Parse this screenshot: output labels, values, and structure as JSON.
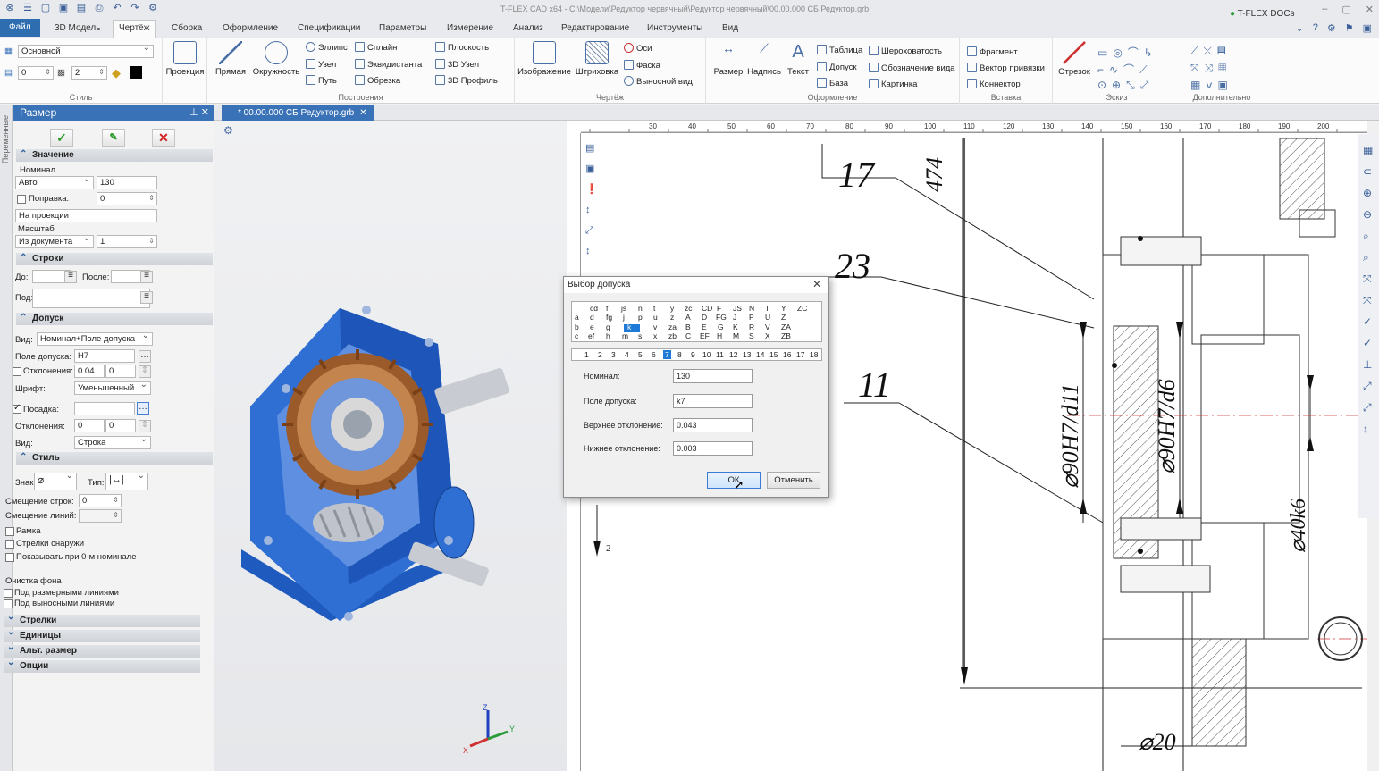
{
  "titlebar": {
    "title": "T-FLEX CAD x64 - C:\\Модели\\Редуктор червячный\\Редуктор червячный\\00.00.000 СБ Редуктор.grb",
    "docs_label": "T-FLEX DOCs"
  },
  "tabs": [
    "Файл",
    "3D Модель",
    "Чертёж",
    "Сборка",
    "Оформление",
    "Спецификации",
    "Параметры",
    "Измерение",
    "Анализ",
    "Редактирование",
    "Инструменты",
    "Вид"
  ],
  "ribbon": {
    "style": {
      "layer": "Основной",
      "v1": "0",
      "v2": "2",
      "label": "Стиль"
    },
    "projection": "Проекция",
    "build": {
      "line": "Прямая",
      "circle": "Окружность",
      "ellipse": "Эллипс",
      "spline": "Сплайн",
      "node": "Узел",
      "equidistant": "Эквидистанта",
      "path": "Путь",
      "trim": "Обрезка",
      "plane": "Плоскость",
      "node3d": "3D Узел",
      "profile3d": "3D Профиль",
      "label": "Построения"
    },
    "drawing": {
      "image": "Изображение",
      "hatch": "Штриховка",
      "axes": "Оси",
      "chamfer": "Фаска",
      "callout": "Выносной вид",
      "label": "Чертёж"
    },
    "format": {
      "size": "Размер",
      "inscription": "Надпись",
      "text": "Текст",
      "table": "Таблица",
      "tolerance": "Допуск",
      "base": "База",
      "roughness": "Шероховатость",
      "view_mark": "Обозначение вида",
      "picture": "Картинка",
      "label": "Оформление"
    },
    "insert": {
      "fragment": "Фрагмент",
      "snap_vector": "Вектор привязки",
      "connector": "Коннектор",
      "label": "Вставка"
    },
    "sketch": {
      "segment": "Отрезок",
      "label": "Эскиз"
    },
    "extra": {
      "label": "Дополнительно"
    }
  },
  "left_strip": "Переменные",
  "panel": {
    "title": "Размер",
    "sections": {
      "value": "Значение",
      "lines": "Строки",
      "tolerance": "Допуск",
      "style": "Стиль",
      "arrows": "Стрелки",
      "units": "Единицы",
      "alt": "Альт. размер",
      "options": "Опции"
    },
    "nominal_label": "Номинал",
    "nominal_mode": "Авто",
    "nominal_value": "130",
    "correction_label": "Поправка:",
    "correction_value": "0",
    "projection_btn": "На проекции",
    "scale_label": "Масштаб",
    "scale_mode": "Из документа",
    "scale_value": "1",
    "before_label": "До:",
    "after_label": "После:",
    "under_label": "Под:",
    "view_label": "Вид:",
    "view_value": "Номинал+Поле допуска",
    "field_label": "Поле допуска:",
    "field_value": "H7",
    "deviation_label": "Отклонения:",
    "deviation_v1": "0.04",
    "deviation_v2": "0",
    "font_label": "Шрифт:",
    "font_value": "Уменьшенный",
    "fit_label": "Посадка:",
    "fit_dev_label": "Отклонения:",
    "fit_dev_v1": "0",
    "fit_dev_v2": "0",
    "fit_view_label": "Вид:",
    "fit_view_value": "Строка",
    "sign_label": "Знак:",
    "type_label": "Тип:",
    "row_offset_label": "Смещение строк:",
    "row_offset_value": "0",
    "line_offset_label": "Смещение линий:",
    "frame_label": "Рамка",
    "arrows_out_label": "Стрелки снаружи",
    "show_zero_label": "Показывать при 0-м номинале",
    "bg_clear_label": "Очистка фона",
    "under_dim_label": "Под размерными линиями",
    "under_ext_label": "Под выносными линиями"
  },
  "document_tab": "* 00.00.000 СБ Редуктор.grb",
  "drawing": {
    "labels": [
      "17",
      "23",
      "11",
      "474",
      "⌀90H7/d11",
      "⌀90H7/d6",
      "⌀40k6",
      "⌀20",
      "2"
    ],
    "ruler": [
      "30",
      "40",
      "50",
      "60",
      "70",
      "80",
      "90",
      "100",
      "110",
      "120",
      "130",
      "140",
      "150",
      "160",
      "170",
      "180",
      "190",
      "200"
    ]
  },
  "dialog": {
    "title": "Выбор допуска",
    "letters": [
      [
        "",
        "cd",
        "f",
        "js",
        "n",
        "t",
        "y",
        "zc",
        "CD",
        "F",
        "JS",
        "N",
        "T",
        "Y",
        "ZC"
      ],
      [
        "a",
        "d",
        "fg",
        "j",
        "p",
        "u",
        "z",
        "A",
        "D",
        "FG",
        "J",
        "P",
        "U",
        "Z",
        ""
      ],
      [
        "b",
        "e",
        "g",
        "k",
        "r",
        "v",
        "za",
        "B",
        "E",
        "G",
        "K",
        "R",
        "V",
        "ZA",
        ""
      ],
      [
        "c",
        "ef",
        "h",
        "m",
        "s",
        "x",
        "zb",
        "C",
        "EF",
        "H",
        "M",
        "S",
        "X",
        "ZB",
        ""
      ]
    ],
    "numbers": [
      "1",
      "2",
      "3",
      "4",
      "5",
      "6",
      "7",
      "8",
      "9",
      "10",
      "11",
      "12",
      "13",
      "14",
      "15",
      "16",
      "17",
      "18"
    ],
    "selected_number": "7",
    "nominal_label": "Номинал:",
    "nominal_value": "130",
    "field_label": "Поле допуска:",
    "field_value": "k7",
    "upper_label": "Верхнее отклонение:",
    "upper_value": "0.043",
    "lower_label": "Нижнее отклонение:",
    "lower_value": "0.003",
    "ok_label": "ОК",
    "cancel_label": "Отменить"
  },
  "colors": {
    "accent": "#3a72b8",
    "selection": "#1f7ad6",
    "model_blue": "#2f6fd3",
    "gear_brown": "#9a5a2a"
  }
}
